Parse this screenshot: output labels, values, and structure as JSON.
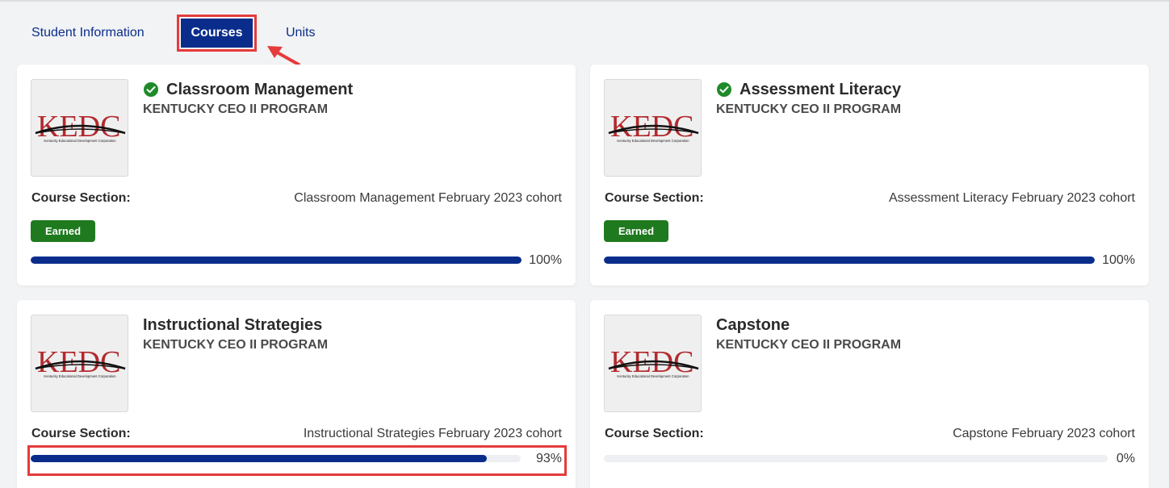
{
  "tabs": {
    "student_information": "Student Information",
    "courses": "Courses",
    "units": "Units",
    "active": "Courses"
  },
  "colors": {
    "accent": "#0a2d8c",
    "earned": "#1f7a1f",
    "highlight": "#e53b3b",
    "check": "#1f8a2a"
  },
  "section_label": "Course Section:",
  "logo_text": "KEDC",
  "logo_subtitle": "Kentucky Educational Development Corporation",
  "courses": [
    {
      "title": "Classroom Management",
      "completed": true,
      "program": "KENTUCKY CEO II PROGRAM",
      "section": "Classroom Management February 2023 cohort",
      "badge": "Earned",
      "progress": 1.0,
      "progress_label": "100%"
    },
    {
      "title": "Assessment Literacy",
      "completed": true,
      "program": "KENTUCKY CEO II PROGRAM",
      "section": "Assessment Literacy February 2023 cohort",
      "badge": "Earned",
      "progress": 1.0,
      "progress_label": "100%"
    },
    {
      "title": "Instructional Strategies",
      "completed": false,
      "program": "KENTUCKY CEO II PROGRAM",
      "section": "Instructional Strategies February 2023 cohort",
      "badge": "",
      "progress": 0.93,
      "progress_label": "93%"
    },
    {
      "title": "Capstone",
      "completed": false,
      "program": "KENTUCKY CEO II PROGRAM",
      "section": "Capstone February 2023 cohort",
      "badge": "",
      "progress": 0.0,
      "progress_label": "0%"
    }
  ],
  "icons": {
    "check": "check-circle-icon",
    "arrow": "annotation-arrow-icon"
  }
}
